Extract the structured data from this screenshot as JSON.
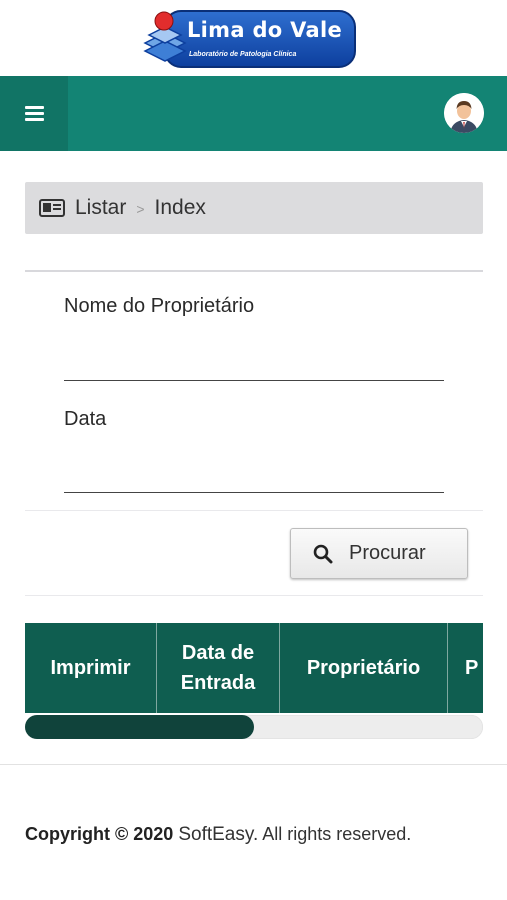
{
  "brand": {
    "name": "Lima do Vale",
    "subtitle": "Laboratório de Patologia Clínica"
  },
  "colors": {
    "topbar": "#138474",
    "menu_button": "#117465",
    "table_header": "#0f5e50",
    "scroll_thumb": "#10433b"
  },
  "topbar": {
    "menu_icon": "hamburger-icon",
    "avatar_icon": "user-avatar-icon"
  },
  "breadcrumb": {
    "icon": "id-card-icon",
    "items": [
      "Listar",
      "Index"
    ],
    "separator": ">"
  },
  "form": {
    "fields": [
      {
        "label": "Nome do Proprietário",
        "value": ""
      },
      {
        "label": "Data",
        "value": ""
      }
    ],
    "search_button": {
      "label": "Procurar",
      "icon": "search-icon"
    }
  },
  "table": {
    "columns": [
      "Imprimir",
      "Data de Entrada",
      "Proprietário",
      "P"
    ],
    "scroll_position": 0.5
  },
  "footer": {
    "copyright": "Copyright © 2020",
    "company": "SoftEasy.",
    "rights": "All rights reserved."
  }
}
